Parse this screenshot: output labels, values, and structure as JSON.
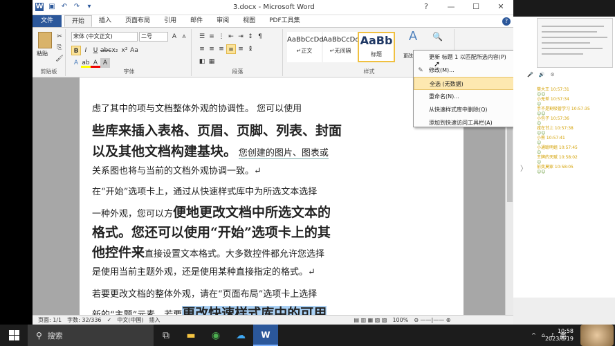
{
  "window": {
    "title": "3.docx - Microsoft Word",
    "controls": [
      "?",
      "—",
      "☐",
      "✕"
    ]
  },
  "tabs": [
    "文件",
    "开始",
    "插入",
    "页面布局",
    "引用",
    "邮件",
    "审阅",
    "视图",
    "PDF工具集"
  ],
  "ribbon": {
    "clipboard": {
      "paste": "粘贴",
      "label": "剪贴板"
    },
    "font": {
      "name": "宋体 (中文正文)",
      "size": "二号",
      "label": "字体"
    },
    "paragraph": {
      "label": "段落"
    },
    "styles": {
      "label": "样式",
      "items": [
        {
          "preview": "AaBbCcDd",
          "name": "↵正文"
        },
        {
          "preview": "AaBbCcDd",
          "name": "↵无间隔"
        },
        {
          "preview": "AaBb",
          "name": "标题"
        }
      ]
    },
    "change_styles": "更改样式",
    "edit": "编辑"
  },
  "context_menu": {
    "items": [
      "更新 标题 1 以匹配所选内容(P)",
      "修改(M)...",
      "全选 (无数据)",
      "重命名(N)...",
      "从快速样式库中删除(Q)",
      "添加到快速访问工具栏(A)"
    ]
  },
  "document": {
    "lines": [
      {
        "t": "虑了其中的项与文档整体外观的协调性。 您可以使用"
      },
      {
        "t": "些库来插入表格、页眉、页脚、列表、封面"
      },
      {
        "a": "以及其他文档构建基块。",
        "b": "您创建的图片、图表或"
      },
      {
        "t": "关系图也将与当前的文档外观协调一致。↵"
      },
      {
        "t": "在“开始”选项卡上，通过从快速样式库中为所选文本选择"
      },
      {
        "a": "一种外观，您可以方",
        "b": "便地更改文档中所选文本的"
      },
      {
        "t": "格式。您还可以使用“开始”选项卡上的其"
      },
      {
        "a": "他控件来",
        "b": "直接设置文本格式。大多数控件都允许您选择"
      },
      {
        "t": "是使用当前主题外观，还是使用某种直接指定的格式。↵"
      },
      {
        "t": "若要更改文档的整体外观，请在“页面布局”选项卡上选择"
      },
      {
        "a": "新的“主题”元素。若要",
        "b": "更改快速样式库中的可用"
      }
    ]
  },
  "status": {
    "page": "页面: 1/1",
    "words": "字数: 32/336",
    "lang": "中文(中国)",
    "mode": "插入",
    "zoom": "100%"
  },
  "side": {
    "chat": [
      "樊大王 10:57:31",
      "小无差 10:57:34",
      "手不是割吸管学习 10:57:35",
      "小包子 10:57:36",
      "咸在甘上 10:57:38",
      "小熊 10:57:41",
      "小通聪明姐 10:57:45",
      "王牌的天赋 10:58:02",
      "前奕莫家 10:58:05"
    ]
  },
  "taskbar": {
    "search": "搜索",
    "ime": "英",
    "clock_time": "10:58",
    "clock_date": "2023/8/19"
  },
  "colors": {
    "word_blue": "#2b579a",
    "highlight": "#aad1f5",
    "menu_hover": "#fde8b0"
  }
}
